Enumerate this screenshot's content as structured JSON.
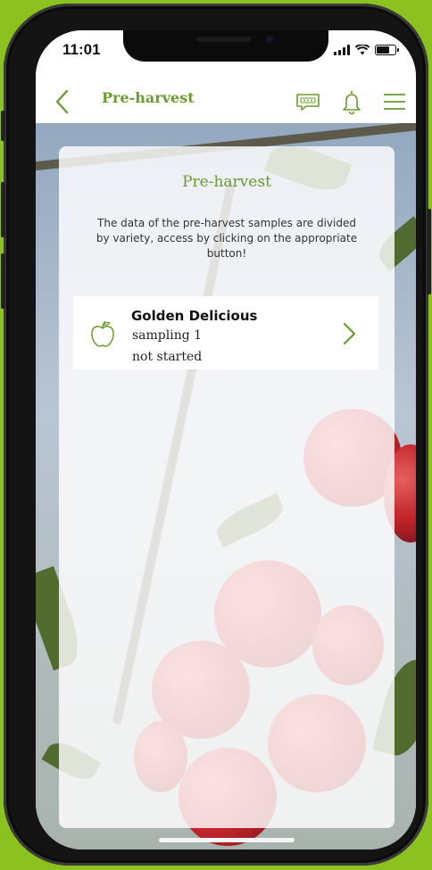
{
  "status_bar": {
    "time": "11:01"
  },
  "header": {
    "title": "Pre-harvest"
  },
  "card": {
    "title": "Pre-harvest",
    "description": "The data of the pre-harvest samples are divided by variety, access by clicking on the appropriate button!"
  },
  "varieties": [
    {
      "name": "Golden Delicious",
      "sampling": "sampling 1",
      "status": "not started",
      "icon": "apple-icon"
    }
  ],
  "colors": {
    "accent": "#6a9b2e",
    "frame": "#8cc21f"
  },
  "icons": {
    "back": "chevron-left-icon",
    "chat": "chat-bubble-icon",
    "bell": "bell-icon",
    "menu": "hamburger-menu-icon",
    "forward": "chevron-right-icon"
  }
}
